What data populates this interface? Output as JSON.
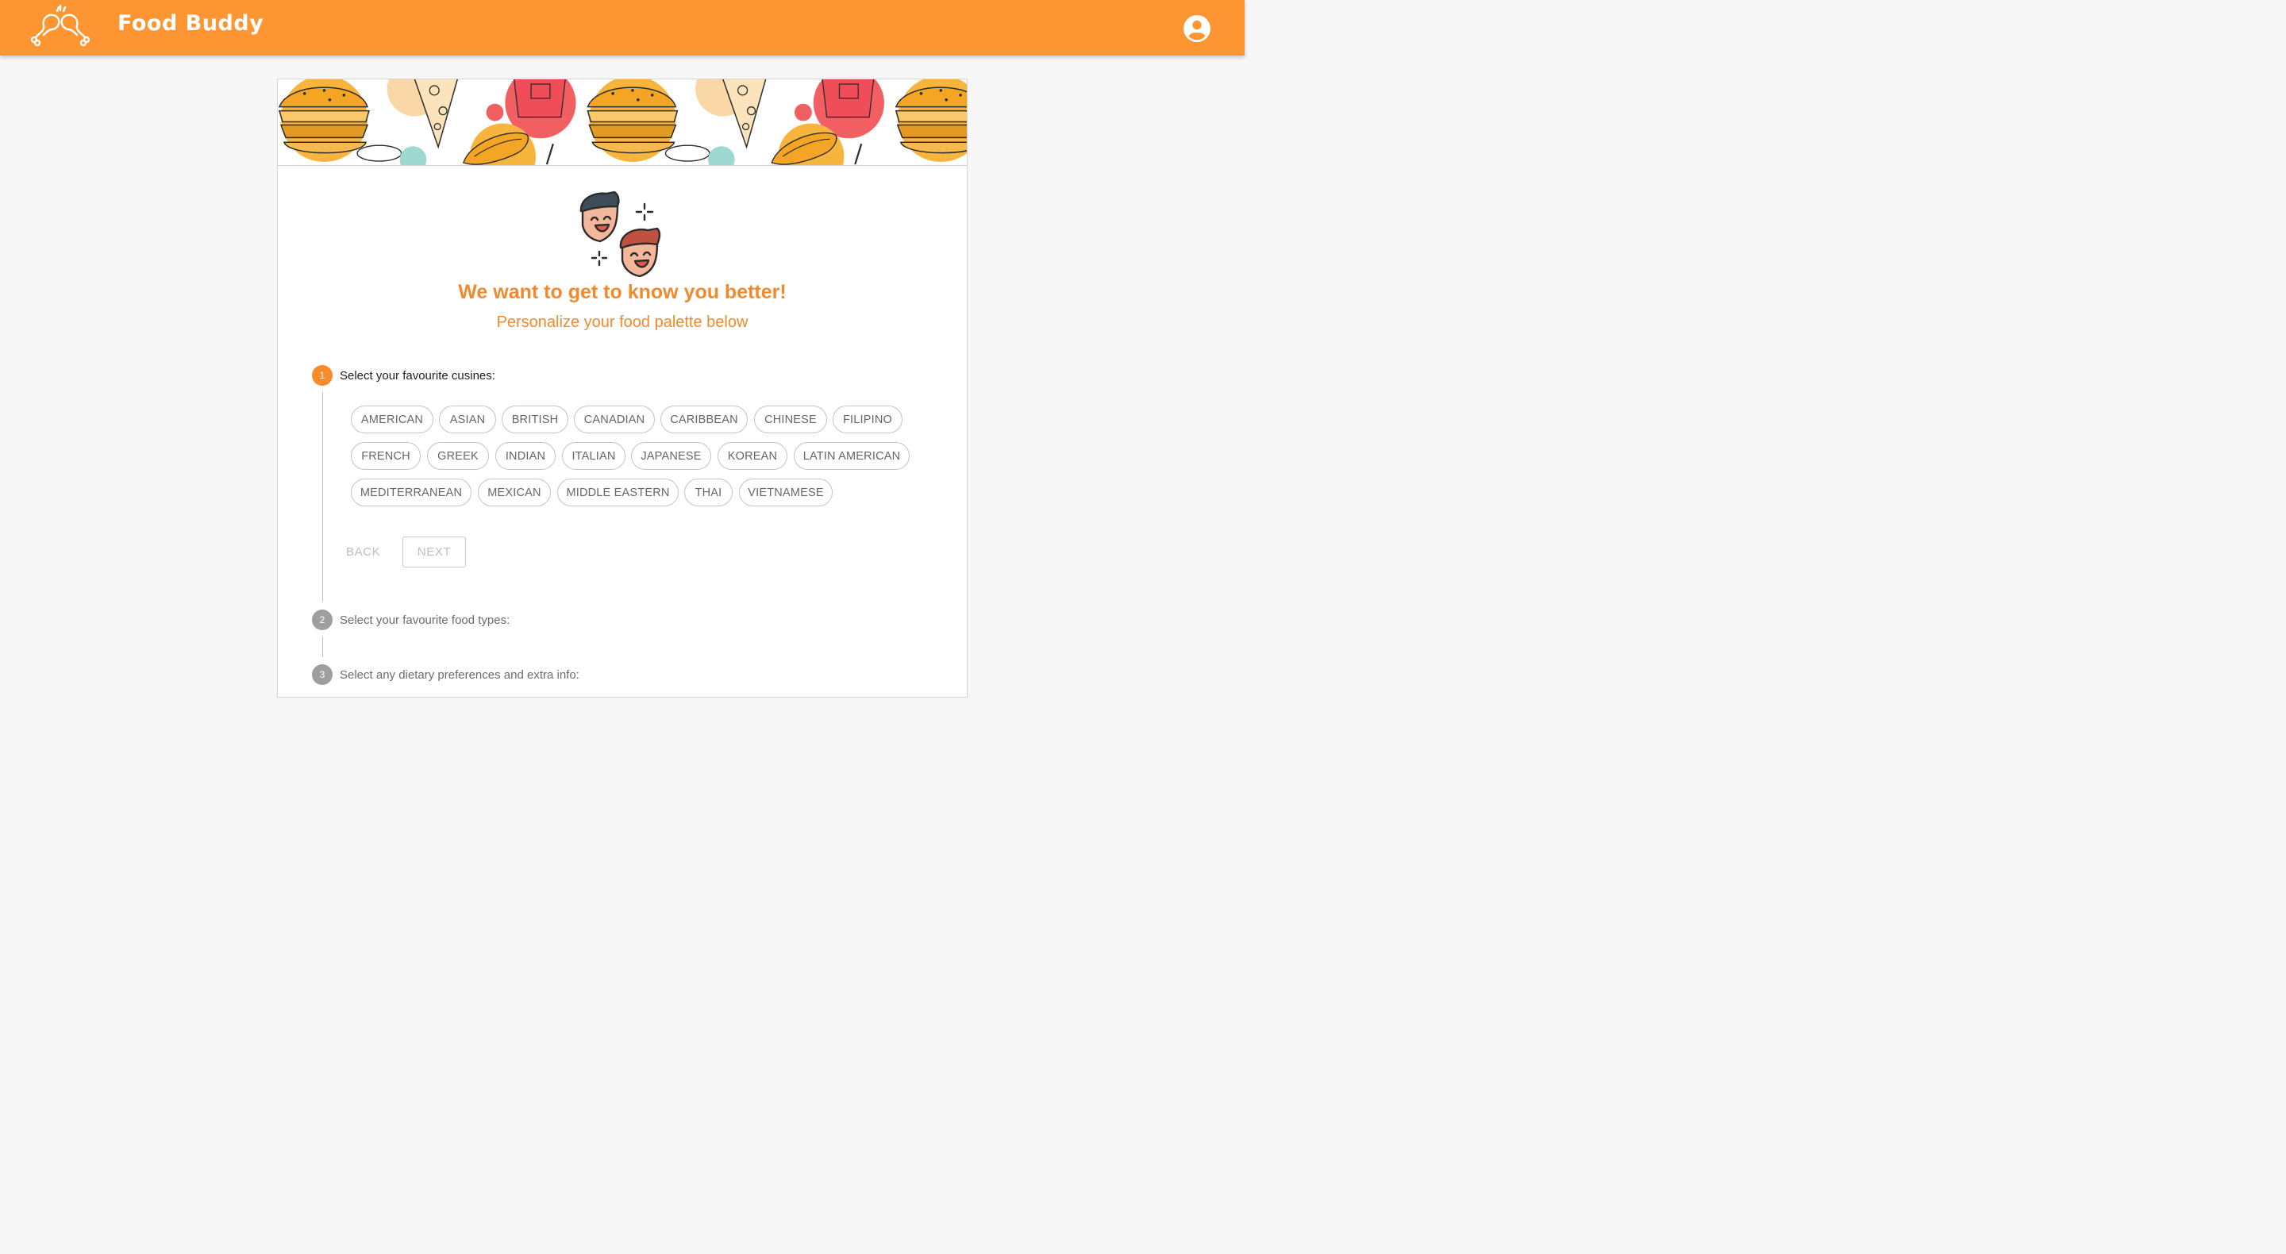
{
  "app": {
    "title": "Food Buddy",
    "logo_icon": "chicken-drumsticks-cheers-icon",
    "profile_icon": "account-circle-icon",
    "brand_color": "#fc9532"
  },
  "intro": {
    "mascot_icon": "two-happy-friends-icon",
    "headline": "We want to get to know you better!",
    "subheadline": "Personalize your food palette below",
    "accent_color": "#f28a2d"
  },
  "steps": [
    {
      "number": "1",
      "label": "Select your favourite cusines:",
      "state": "active"
    },
    {
      "number": "2",
      "label": "Select your favourite food types:",
      "state": "inactive"
    },
    {
      "number": "3",
      "label": "Select any dietary preferences and extra info:",
      "state": "inactive"
    }
  ],
  "cuisines": [
    "AMERICAN",
    "ASIAN",
    "BRITISH",
    "CANADIAN",
    "CARIBBEAN",
    "CHINESE",
    "FILIPINO",
    "FRENCH",
    "GREEK",
    "INDIAN",
    "ITALIAN",
    "JAPANESE",
    "KOREAN",
    "LATIN AMERICAN",
    "MEDITERRANEAN",
    "MEXICAN",
    "MIDDLE EASTERN",
    "THAI",
    "VIETNAMESE"
  ],
  "actions": {
    "back_label": "BACK",
    "next_label": "NEXT"
  }
}
